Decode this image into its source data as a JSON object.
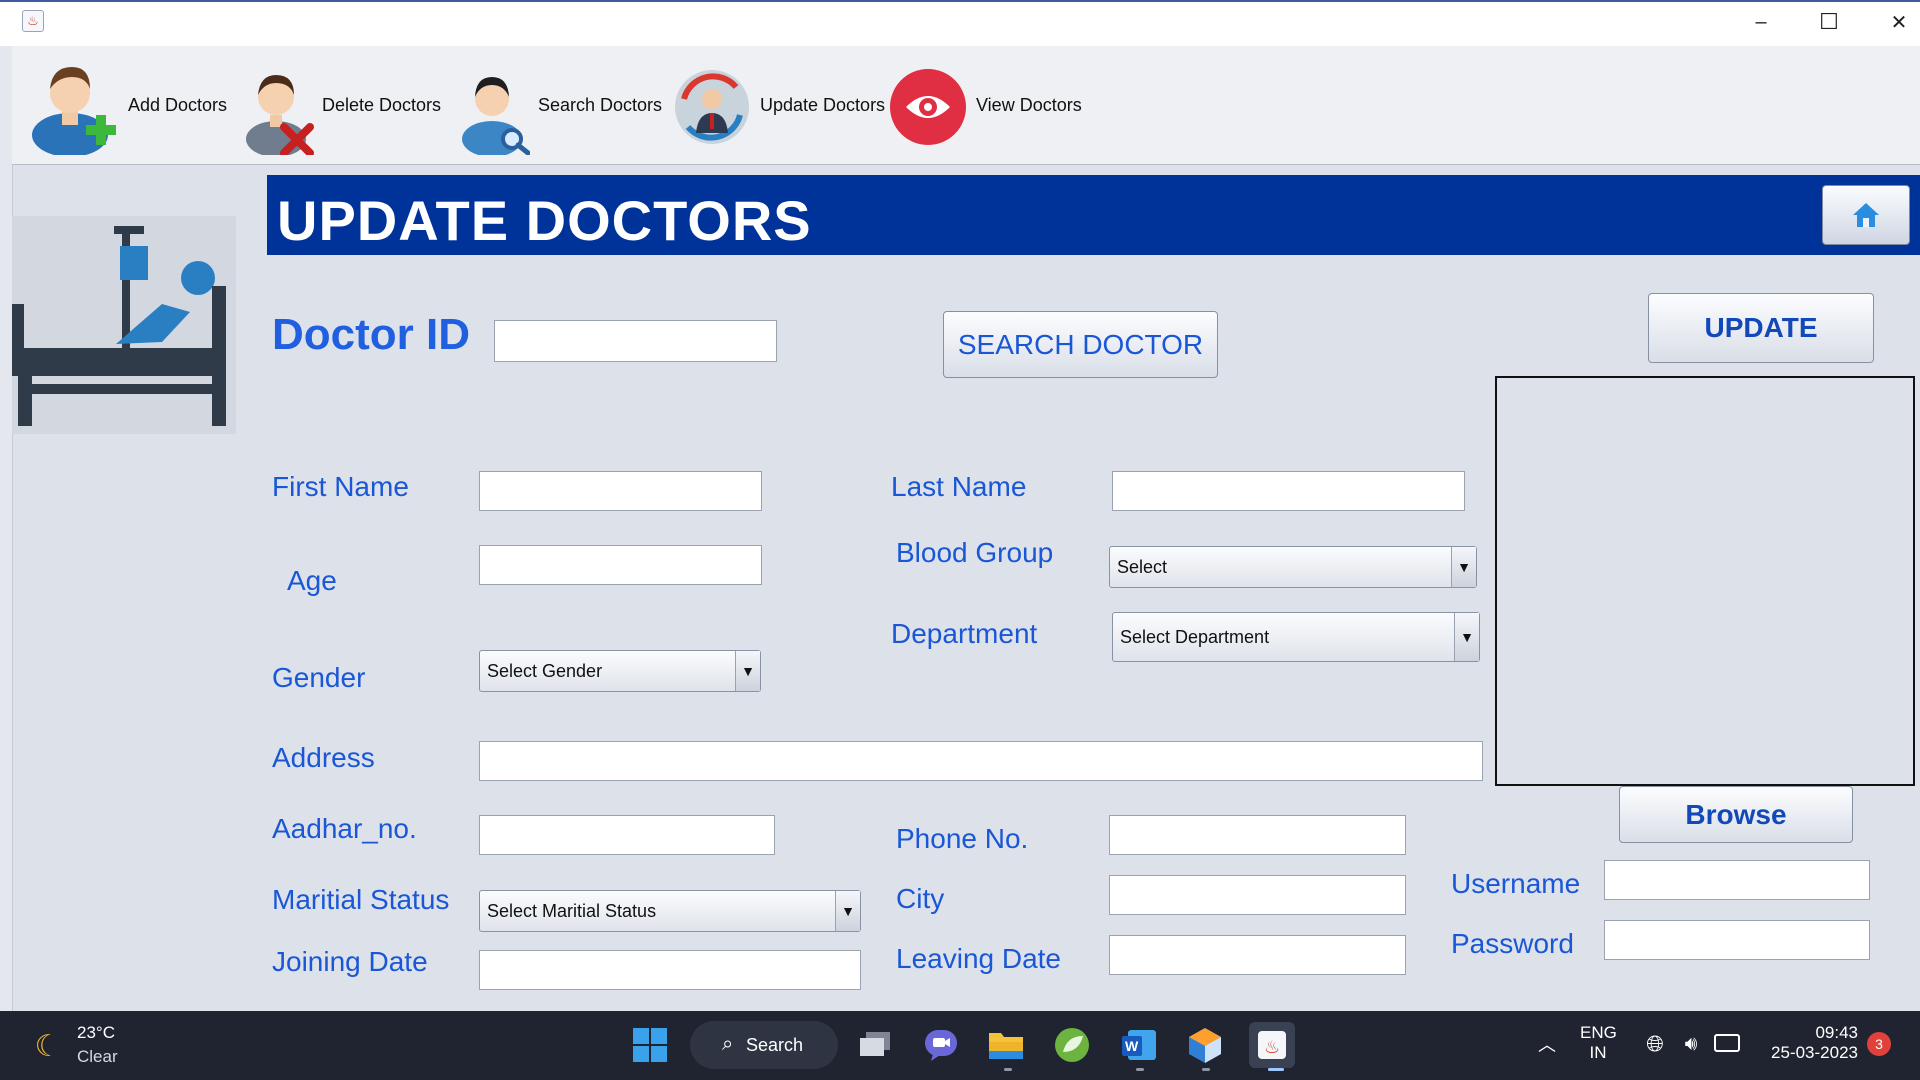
{
  "window": {
    "minimize": "–",
    "maximize": "☐",
    "close": "✕"
  },
  "toolbar": {
    "items": [
      {
        "label": "Add Doctors",
        "icon": "add-doctor-icon"
      },
      {
        "label": "Delete Doctors",
        "icon": "delete-doctor-icon"
      },
      {
        "label": "Search Doctors",
        "icon": "search-doctor-icon"
      },
      {
        "label": "Update Doctors",
        "icon": "update-doctor-icon"
      },
      {
        "label": "View Doctors",
        "icon": "view-doctor-icon"
      }
    ]
  },
  "header": {
    "title": "UPDATE DOCTORS",
    "home_icon": "home-icon"
  },
  "form": {
    "doctor_id_label": "Doctor ID",
    "doctor_id_value": "",
    "search_button": "SEARCH DOCTOR",
    "update_button": "UPDATE",
    "browse_button": "Browse",
    "first_name_label": "First Name",
    "last_name_label": "Last Name",
    "age_label": "Age",
    "blood_group_label": "Blood Group",
    "blood_group_value": "Select",
    "department_label": "Department",
    "department_value": "Select Department",
    "gender_label": "Gender",
    "gender_value": "Select Gender",
    "address_label": "Address",
    "aadhar_label": "Aadhar_no.",
    "phone_label": "Phone No.",
    "marital_label": "Maritial Status",
    "marital_value": "Select Maritial Status",
    "city_label": "City",
    "joining_label": "Joining Date",
    "leaving_label": "Leaving Date",
    "username_label": "Username",
    "password_label": "Password"
  },
  "taskbar": {
    "weather_temp": "23°C",
    "weather_cond": "Clear",
    "search_label": "Search",
    "lang_top": "ENG",
    "lang_bottom": "IN",
    "time": "09:43",
    "date": "25-03-2023",
    "notification_count": "3"
  },
  "colors": {
    "header_bg": "#003399",
    "label_blue": "#1a57d6",
    "taskbar": "#1f2430"
  }
}
